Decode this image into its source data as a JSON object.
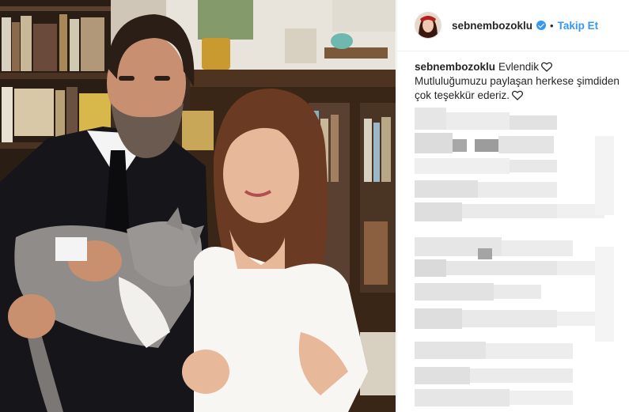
{
  "post": {
    "username": "sebnembozoklu",
    "separator": "•",
    "follow_label": "Takip Et",
    "verified": true,
    "caption": {
      "username": "sebnembozoklu",
      "line1": "Evlendik",
      "line2": "Mutluluğumuzu paylaşan herkese şimdiden",
      "line3": "çok teşekkür ederiz."
    }
  },
  "colors": {
    "accent": "#3897f0",
    "text": "#262626",
    "border": "#efefef"
  },
  "icons": [
    "verified-badge-icon",
    "heart-icon",
    "heart-icon"
  ]
}
